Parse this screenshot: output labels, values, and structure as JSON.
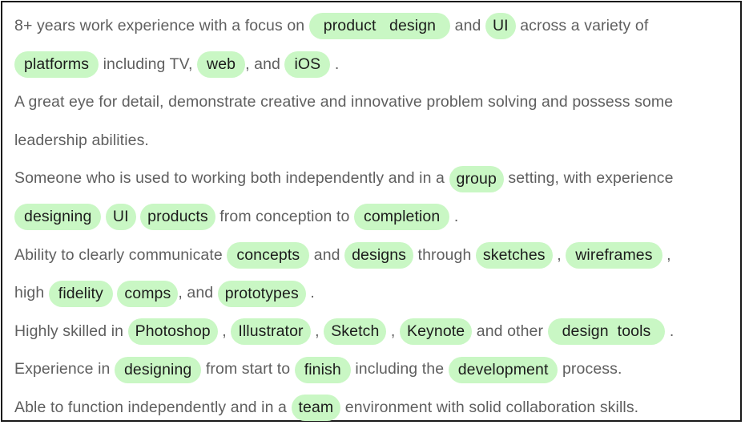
{
  "highlight_color": "#c9f7c4",
  "lines": [
    [
      {
        "t": "8+ years work experience with a focus on "
      },
      {
        "h": "product   design",
        "cls": "wide"
      },
      {
        "t": " and "
      },
      {
        "h": "UI",
        "cls": "tight"
      },
      {
        "t": " across a variety of"
      }
    ],
    [
      {
        "h": "platforms"
      },
      {
        "t": " including TV, "
      },
      {
        "h": "web"
      },
      {
        "t": ", and "
      },
      {
        "h": "iOS"
      },
      {
        "t": " ."
      }
    ],
    [
      {
        "t": "A great eye for detail, demonstrate creative and innovative problem solving and possess some"
      }
    ],
    [
      {
        "t": "leadership abilities."
      }
    ],
    [
      {
        "t": "Someone who is used to working both independently and in a "
      },
      {
        "h": "group",
        "cls": "tight"
      },
      {
        "t": " setting, with experience"
      }
    ],
    [
      {
        "h": "designing"
      },
      {
        "t": " "
      },
      {
        "h": "UI",
        "cls": "tight"
      },
      {
        "t": " "
      },
      {
        "h": "products",
        "cls": "tight"
      },
      {
        "t": " from conception to "
      },
      {
        "h": "completion"
      },
      {
        "t": " ."
      }
    ],
    [
      {
        "t": "Ability to clearly communicate "
      },
      {
        "h": "concepts"
      },
      {
        "t": " and "
      },
      {
        "h": "designs",
        "cls": "tight"
      },
      {
        "t": " through "
      },
      {
        "h": "sketches",
        "cls": "tight"
      },
      {
        "t": " , "
      },
      {
        "h": "wireframes"
      },
      {
        "t": " ,"
      }
    ],
    [
      {
        "t": "high "
      },
      {
        "h": "fidelity"
      },
      {
        "t": " "
      },
      {
        "h": "comps",
        "cls": "tight"
      },
      {
        "t": ", and "
      },
      {
        "h": "prototypes",
        "cls": "tight"
      },
      {
        "t": " ."
      }
    ],
    [
      {
        "t": "Highly skilled in "
      },
      {
        "h": "Photoshop",
        "cls": "tight"
      },
      {
        "t": " , "
      },
      {
        "h": "Illustrator",
        "cls": "tight"
      },
      {
        "t": " , "
      },
      {
        "h": "Sketch",
        "cls": "tight"
      },
      {
        "t": " , "
      },
      {
        "h": "Keynote",
        "cls": "tight"
      },
      {
        "t": " and other "
      },
      {
        "h": "design  tools",
        "cls": "wide"
      },
      {
        "t": " ."
      }
    ],
    [
      {
        "t": "Experience in "
      },
      {
        "h": "designing"
      },
      {
        "t": " from start to "
      },
      {
        "h": "finish"
      },
      {
        "t": " including the "
      },
      {
        "h": "development"
      },
      {
        "t": " process."
      }
    ],
    [
      {
        "t": "Able to function independently and in a "
      },
      {
        "h": "team",
        "cls": "tight"
      },
      {
        "t": " environment with solid collaboration skills."
      }
    ]
  ]
}
